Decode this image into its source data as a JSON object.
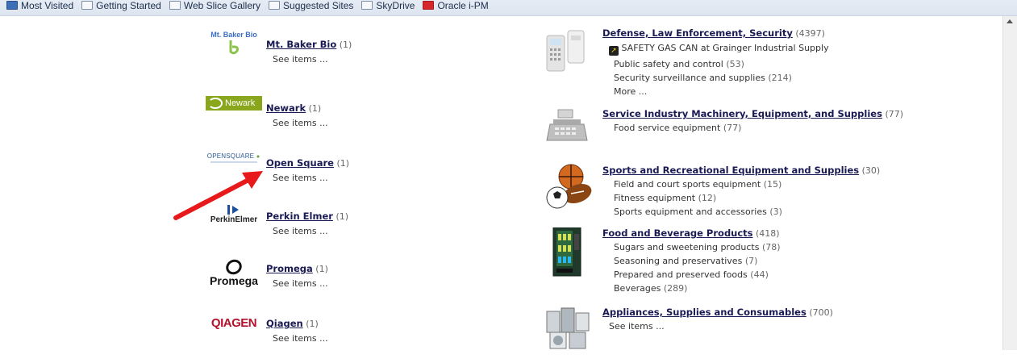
{
  "favorites": [
    {
      "label": "Most Visited",
      "icon": "folder-icon"
    },
    {
      "label": "Getting Started",
      "icon": "page-icon"
    },
    {
      "label": "Web Slice Gallery",
      "icon": "page-icon"
    },
    {
      "label": "Suggested Sites",
      "icon": "page-icon"
    },
    {
      "label": "SkyDrive",
      "icon": "page-icon"
    },
    {
      "label": "Oracle i-PM",
      "icon": "oracle-icon"
    }
  ],
  "manufacturers": [
    {
      "name": "Mt. Baker Bio",
      "count": "(1)",
      "see": "See items ...",
      "logo_text": "Mt. Baker Bio"
    },
    {
      "name": "Newark",
      "count": "(1)",
      "see": "See items ...",
      "logo_text": "Newark"
    },
    {
      "name": "Open Square",
      "count": "(1)",
      "see": "See items ...",
      "logo_text": "OPENSQUARE"
    },
    {
      "name": "Perkin Elmer",
      "count": "(1)",
      "see": "See items ...",
      "logo_text": "PerkinElmer"
    },
    {
      "name": "Promega",
      "count": "(1)",
      "see": "See items ...",
      "logo_text": "Promega"
    },
    {
      "name": "Qiagen",
      "count": "(1)",
      "see": "See items ...",
      "logo_text": "QIAGEN"
    }
  ],
  "categories": [
    {
      "name": "Defense, Law Enforcement, Security",
      "count": "(4397)",
      "featured": "SAFETY GAS CAN at Grainger Industrial Supply",
      "subs": [
        {
          "label": "Public safety and control",
          "count": "(53)"
        },
        {
          "label": "Security surveillance and supplies",
          "count": "(214)"
        }
      ],
      "more": "More ..."
    },
    {
      "name": "Service Industry Machinery, Equipment, and Supplies",
      "count": "(77)",
      "subs": [
        {
          "label": "Food service equipment",
          "count": "(77)"
        }
      ]
    },
    {
      "name": "Sports and Recreational Equipment and Supplies",
      "count": "(30)",
      "subs": [
        {
          "label": "Field and court sports equipment",
          "count": "(15)"
        },
        {
          "label": "Fitness equipment",
          "count": "(12)"
        },
        {
          "label": "Sports equipment and accessories",
          "count": "(3)"
        }
      ]
    },
    {
      "name": "Food and Beverage Products",
      "count": "(418)",
      "subs": [
        {
          "label": "Sugars and sweetening products",
          "count": "(78)"
        },
        {
          "label": "Seasoning and preservatives",
          "count": "(7)"
        },
        {
          "label": "Prepared and preserved foods",
          "count": "(44)"
        },
        {
          "label": "Beverages",
          "count": "(289)"
        }
      ]
    },
    {
      "name": "Appliances, Supplies and Consumables",
      "count": "(700)",
      "see": "See items ..."
    }
  ],
  "colors": {
    "link": "#1a1a55",
    "arrow": "#e8191a"
  }
}
